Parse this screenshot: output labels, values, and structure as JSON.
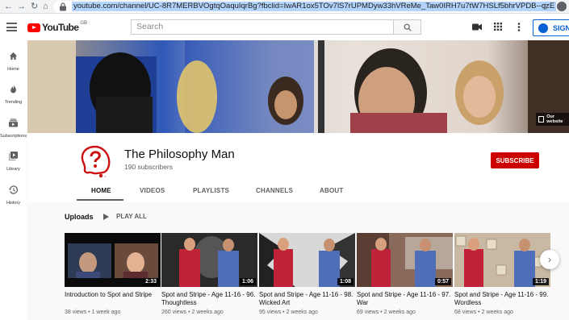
{
  "browser": {
    "url": "youtube.com/channel/UC-8R7MERBVOgtqOaquIqrBg?fbclid=IwAR1ox5TOv7lS7rUPMDyw33hVReMe_Taw0IRH7u7tW7HSLf5bhrVPDB--qzE"
  },
  "masthead": {
    "logo_text": "YouTube",
    "region": "GB",
    "search_placeholder": "Search",
    "signin_label": "SIGN"
  },
  "guide": [
    {
      "label": "Home",
      "icon": "home-icon"
    },
    {
      "label": "Trending",
      "icon": "trending-icon"
    },
    {
      "label": "Subscriptions",
      "icon": "subscriptions-icon"
    },
    {
      "label": "Library",
      "icon": "library-icon"
    },
    {
      "label": "History",
      "icon": "history-icon"
    }
  ],
  "banner": {
    "link_label": "Our website"
  },
  "channel": {
    "name": "The Philosophy Man",
    "subscribers": "190 subscribers",
    "subscribe_label": "SUBSCRIBE"
  },
  "tabs": [
    "HOME",
    "VIDEOS",
    "PLAYLISTS",
    "CHANNELS",
    "ABOUT"
  ],
  "section": {
    "title": "Uploads",
    "play_all": "PLAY ALL"
  },
  "videos": [
    {
      "title": "Introduction to Spot and Stripe",
      "duration": "2:33",
      "views": "38 views",
      "age": "1 week ago"
    },
    {
      "title": "Spot and Stripe - Age 11-16 - 96. Thoughtless",
      "duration": "1:06",
      "views": "260 views",
      "age": "2 weeks ago"
    },
    {
      "title": "Spot and Stripe - Age 11-16 - 98. Wicked Art",
      "duration": "1:08",
      "views": "95 views",
      "age": "2 weeks ago"
    },
    {
      "title": "Spot and Stripe - Age 11-16 - 97. War",
      "duration": "0:57",
      "views": "69 views",
      "age": "2 weeks ago"
    },
    {
      "title": "Spot and Stripe - Age 11-16 - 99. Wordless",
      "duration": "1:19",
      "views": "68 views",
      "age": "2 weeks ago"
    }
  ],
  "colors": {
    "brand_red": "#ff0000",
    "subscribe_red": "#cc0000",
    "signin_blue": "#065fd4"
  }
}
